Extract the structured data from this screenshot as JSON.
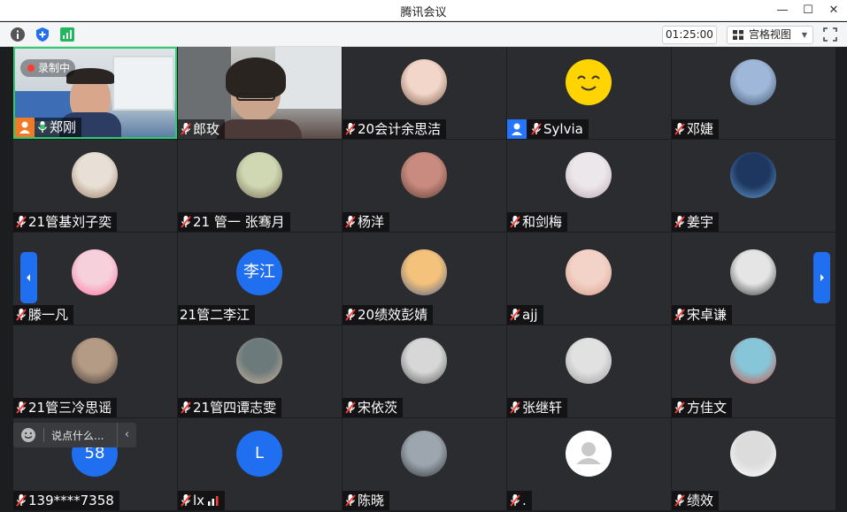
{
  "window": {
    "title": "腾讯会议"
  },
  "toolbar": {
    "info_icon": "info-icon",
    "security_icon": "shield-icon",
    "network_icon": "signal-icon",
    "timer": "01:25:00",
    "view_label": "宫格视图",
    "fullscreen_icon": "fullscreen-icon"
  },
  "recording": {
    "label": "录制中"
  },
  "participants": [
    {
      "name": "郑刚",
      "muted": false,
      "role": "host",
      "video": true
    },
    {
      "name": "郎玫",
      "muted": true,
      "video": true
    },
    {
      "name": "20会计余思洁",
      "muted": true
    },
    {
      "name": "Sylvia",
      "muted": true,
      "role": "cohost"
    },
    {
      "name": "邓婕",
      "muted": true
    },
    {
      "name": "21管基刘子奕",
      "muted": true
    },
    {
      "name": "21 管一 张骞月",
      "muted": true
    },
    {
      "name": "杨洋",
      "muted": true
    },
    {
      "name": "和剑梅",
      "muted": true
    },
    {
      "name": "姜宇",
      "muted": true
    },
    {
      "name": "滕一凡",
      "muted": true
    },
    {
      "name": "21管二李江",
      "muted": null,
      "avatar_text": "李江"
    },
    {
      "name": "20绩效彭婧",
      "muted": true
    },
    {
      "name": "ajj",
      "muted": true
    },
    {
      "name": "宋卓谦",
      "muted": true
    },
    {
      "name": "21管三冷思谣",
      "muted": true
    },
    {
      "name": "21管四谭志雯",
      "muted": true
    },
    {
      "name": "宋依茨",
      "muted": true
    },
    {
      "name": "张继轩",
      "muted": true
    },
    {
      "name": "方佳文",
      "muted": true
    },
    {
      "name": "139****7358",
      "muted": true,
      "avatar_text": "58"
    },
    {
      "name": "lx",
      "muted": true,
      "avatar_text": "L"
    },
    {
      "name": "陈晓",
      "muted": true
    },
    {
      "name": ".",
      "muted": true
    },
    {
      "name": "绩效",
      "muted": true
    }
  ],
  "chat": {
    "placeholder": "说点什么...",
    "collapse": "‹"
  },
  "colors": {
    "accent": "#1f6ff0",
    "host": "#f07a26",
    "mute": "#ff3b30",
    "tile": "#2b2c2f"
  }
}
